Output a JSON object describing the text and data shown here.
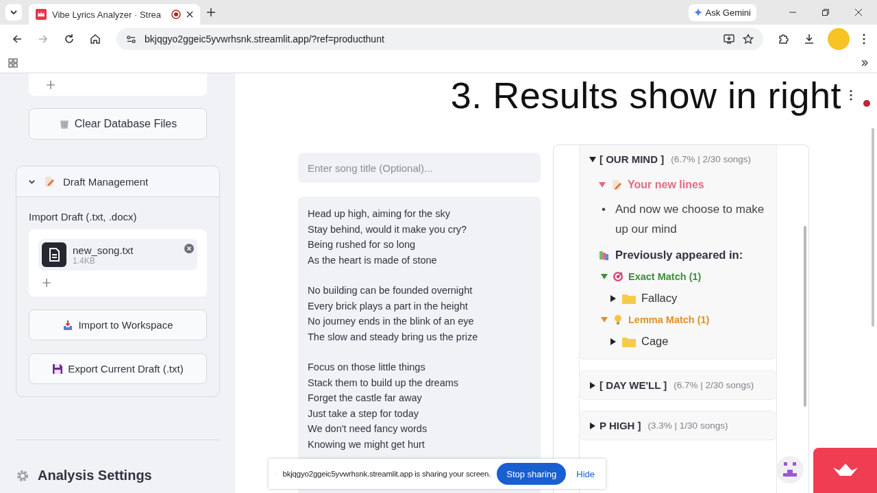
{
  "browser": {
    "tab_title": "Vibe Lyrics Analyzer · Strea",
    "recording": true,
    "ask_gemini": "Ask Gemini",
    "url": "bkjqgyo2ggeic5yvwrhsnk.streamlit.app/?ref=producthunt"
  },
  "sidebar": {
    "clear_button": "Clear Database Files",
    "draft": {
      "title": "Draft Management",
      "expanded": true,
      "import_label": "Import Draft (.txt, .docx)",
      "file": {
        "name": "new_song.txt",
        "size": "1.4KB"
      },
      "buttons": [
        {
          "label": "Import to Workspace",
          "kind": "import"
        },
        {
          "label": "Export Current Draft (.txt)",
          "kind": "export"
        }
      ]
    },
    "settings_title": "Analysis Settings"
  },
  "caption": "3. Results show in right",
  "workspace": {
    "title_placeholder": "Enter song title (Optional)...",
    "stanzas": [
      [
        "Head up high, aiming for the sky",
        "Stay behind, would it make you cry?",
        "Being rushed for so long",
        "As the heart is made of stone"
      ],
      [
        "No building can be founded overnight",
        "Every brick plays a part in the height",
        "No journey ends in the blink of an eye",
        "The slow and steady bring us the prize"
      ],
      [
        "Focus on those little things",
        "Stack them to build up the dreams",
        "Forget the castle far away",
        "Just take a step for today",
        "We don't need fancy words",
        "Knowing we might get hurt"
      ]
    ]
  },
  "radar": {
    "groups": [
      {
        "phrase": "[ OUR MIND ]",
        "stats": "(6.7% | 2/30 songs)",
        "expanded": true,
        "new_lines_label": "Your new lines",
        "bullet": "•",
        "new_lines": [
          "And now we choose to make up our mind"
        ],
        "previous_label": "Previously appeared in:",
        "matches": [
          {
            "kind": "exact",
            "label": "Exact Match (1)",
            "color": "#3a8f3a",
            "expanded": true,
            "songs": [
              {
                "title": "Fallacy",
                "expanded": false
              }
            ]
          },
          {
            "kind": "lemma",
            "label": "Lemma Match (1)",
            "color": "#e0902a",
            "expanded": true,
            "songs": [
              {
                "title": "Cage",
                "expanded": false
              }
            ]
          }
        ]
      },
      {
        "phrase": "[ DAY WE'LL ]",
        "stats": "(6.7% | 2/30 songs)",
        "expanded": false
      },
      {
        "phrase": "P HIGH ]",
        "stats": "(3.3% | 1/30 songs)",
        "expanded": false
      }
    ]
  },
  "share_bar": {
    "message": "bkjqgyo2ggeic5yvwrhsnk.streamlit.app is sharing your screen.",
    "stop": "Stop sharing",
    "hide": "Hide"
  }
}
